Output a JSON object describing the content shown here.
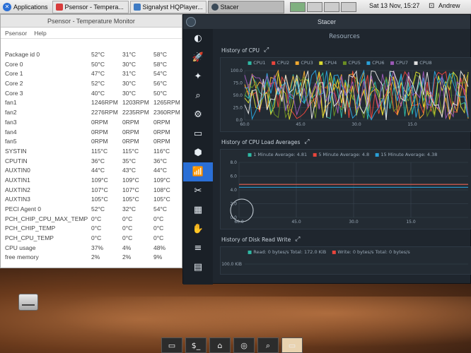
{
  "panel": {
    "apps_label": "Applications",
    "tasks": [
      {
        "label": "Psensor - Tempera...",
        "color": "#d83c3c",
        "active": false
      },
      {
        "label": "Signalyst HQPlayer...",
        "color": "#3e7bc4",
        "active": false
      },
      {
        "label": "Stacer",
        "color": "#3b4a58",
        "active": true
      }
    ],
    "clock": "Sat 13 Nov, 15:27",
    "user": "Andrew"
  },
  "psensor": {
    "title": "Psensor - Temperature Monitor",
    "menu": [
      "Psensor",
      "Help"
    ],
    "rows": [
      [
        "Package id 0",
        "52°C",
        "31°C",
        "58°C"
      ],
      [
        "Core 0",
        "50°C",
        "30°C",
        "58°C"
      ],
      [
        "Core 1",
        "47°C",
        "31°C",
        "54°C"
      ],
      [
        "Core 2",
        "52°C",
        "30°C",
        "56°C"
      ],
      [
        "Core 3",
        "40°C",
        "30°C",
        "50°C"
      ],
      [
        "fan1",
        "1246RPM",
        "1203RPM",
        "1265RPM"
      ],
      [
        "fan2",
        "2276RPM",
        "2235RPM",
        "2360RPM"
      ],
      [
        "fan3",
        "0RPM",
        "0RPM",
        "0RPM"
      ],
      [
        "fan4",
        "0RPM",
        "0RPM",
        "0RPM"
      ],
      [
        "fan5",
        "0RPM",
        "0RPM",
        "0RPM"
      ],
      [
        "SYSTIN",
        "115°C",
        "115°C",
        "116°C"
      ],
      [
        "CPUTIN",
        "36°C",
        "35°C",
        "36°C"
      ],
      [
        "AUXTIN0",
        "44°C",
        "43°C",
        "44°C"
      ],
      [
        "AUXTIN1",
        "109°C",
        "109°C",
        "109°C"
      ],
      [
        "AUXTIN2",
        "107°C",
        "107°C",
        "108°C"
      ],
      [
        "AUXTIN3",
        "105°C",
        "105°C",
        "105°C"
      ],
      [
        "PECI Agent 0",
        "52°C",
        "32°C",
        "54°C"
      ],
      [
        "PCH_CHIP_CPU_MAX_TEMP",
        "0°C",
        "0°C",
        "0°C"
      ],
      [
        "PCH_CHIP_TEMP",
        "0°C",
        "0°C",
        "0°C"
      ],
      [
        "PCH_CPU_TEMP",
        "0°C",
        "0°C",
        "0°C"
      ],
      [
        "CPU usage",
        "37%",
        "4%",
        "48%"
      ],
      [
        "free memory",
        "2%",
        "2%",
        "9%"
      ]
    ]
  },
  "stacer": {
    "title": "Stacer",
    "page_title": "Resources",
    "sidebar": [
      "dashboard-icon",
      "startup-icon",
      "cleaner-icon",
      "search-icon",
      "services-icon",
      "processes-icon",
      "uninstaller-icon",
      "resources-icon",
      "tools-icon",
      "apt-icon",
      "gnome-icon",
      "settings-icon",
      "logs-icon"
    ],
    "sidebar_glyphs": [
      "◐",
      "🚀",
      "✦",
      "⌕",
      "⚙",
      "▭",
      "⬢",
      "📶",
      "✂",
      "▦",
      "✋",
      "≡",
      "▤"
    ],
    "cpu_history": {
      "title": "History of CPU",
      "legend": [
        {
          "name": "CPU1",
          "color": "#2fb9a5"
        },
        {
          "name": "CPU2",
          "color": "#e8453c"
        },
        {
          "name": "CPU3",
          "color": "#f0a830"
        },
        {
          "name": "CPU4",
          "color": "#d8d832"
        },
        {
          "name": "CPU5",
          "color": "#6b8e23"
        },
        {
          "name": "CPU6",
          "color": "#2aa0d8"
        },
        {
          "name": "CPU7",
          "color": "#9b59b6"
        },
        {
          "name": "CPU8",
          "color": "#e0e0e0"
        }
      ],
      "yticks": [
        "100.0",
        "75.0",
        "50.0",
        "25.0",
        "0.0"
      ],
      "xticks": [
        "60.0",
        "45.0",
        "30.0",
        "15.0"
      ]
    },
    "load_history": {
      "title": "History of CPU Load Averages",
      "legend": [
        {
          "name": "1 Minute Average: 4.81",
          "color": "#2fb9a5"
        },
        {
          "name": "5 Minute Average: 4.8",
          "color": "#e8453c"
        },
        {
          "name": "15 Minute Average: 4.38",
          "color": "#2aa0d8"
        }
      ],
      "yticks": [
        "8.0",
        "6.0",
        "4.0",
        "2.0",
        "0.0"
      ],
      "xticks": [
        "60.0",
        "45.0",
        "30.0",
        "15.0"
      ]
    },
    "disk_history": {
      "title": "History of Disk Read Write",
      "legend": [
        {
          "name": "Read: 0 bytes/s Total: 172.0 KiB",
          "color": "#2fb9a5"
        },
        {
          "name": "Write: 0 bytes/s Total: 0 bytes/s",
          "color": "#e8453c"
        }
      ],
      "ytick": "100.0 KiB"
    }
  },
  "dock": [
    "▭",
    "$_",
    "⌂",
    "◎",
    "⌕",
    "▭"
  ]
}
